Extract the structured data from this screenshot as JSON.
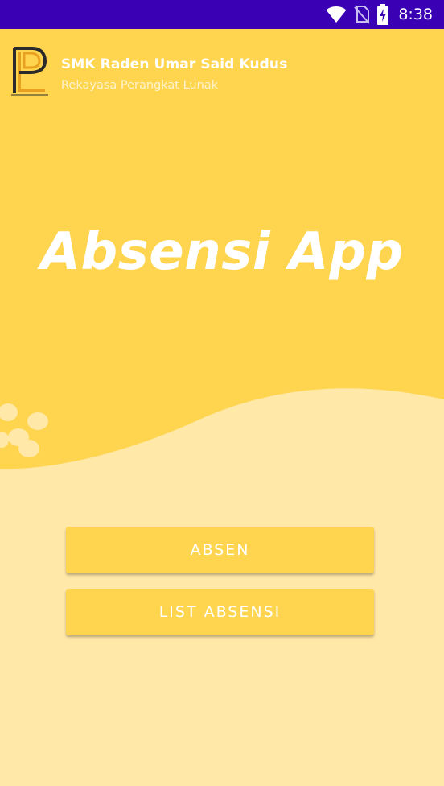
{
  "status_bar": {
    "time": "8:38",
    "icons": [
      "wifi-icon",
      "no-sim-icon",
      "battery-charging-icon"
    ]
  },
  "header": {
    "logo": "RPL-logo",
    "school_name": "SMK Raden Umar Said Kudus",
    "department": "Rekayasa Perangkat Lunak"
  },
  "app_title": "Absensi App",
  "buttons": {
    "absen_label": "ABSEN",
    "list_label": "LIST ABSENSI"
  },
  "colors": {
    "status_bar": "#3A00B4",
    "primary_yellow": "#FFD54F",
    "light_yellow": "#FFE8A8",
    "text": "#FFFFFF"
  }
}
